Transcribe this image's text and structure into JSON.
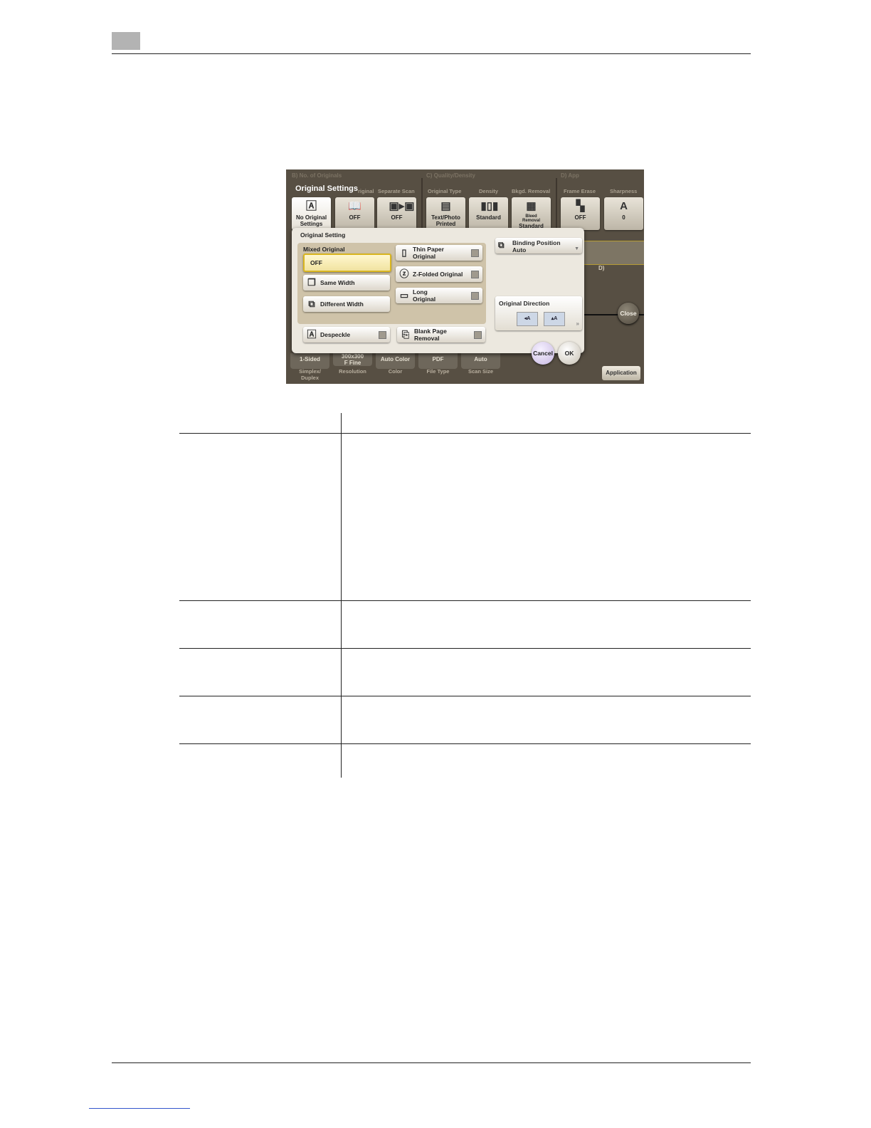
{
  "screen": {
    "sections": [
      {
        "key": "B",
        "label": "B)   No. of Originals"
      },
      {
        "key": "C",
        "label": "C)   Quality/Density"
      },
      {
        "key": "D",
        "label": "D)   App"
      }
    ],
    "title_tab": "Original Settings",
    "column_labels": {
      "orig": "riginal",
      "separate_scan": "Separate Scan",
      "original_type": "Original Type",
      "density": "Density",
      "bkgd_removal": "Bkgd. Removal",
      "frame_erase": "Frame Erase",
      "sharpness": "Sharpness"
    },
    "tiles": {
      "no_original_line1": "No Original",
      "no_original_line2": "Settings",
      "book_off": "OFF",
      "separate_scan_off": "OFF",
      "text_photo_line1": "Text/Photo",
      "text_photo_line2": "Printed",
      "density_value": "Standard",
      "bkgd_line1": "Bleed",
      "bkgd_line2": "Removal",
      "bkgd_line3": "Standard",
      "frame_erase_value": "OFF",
      "sharpness_value": "0"
    },
    "dialog": {
      "title": "Original Setting",
      "mixed_original_label": "Mixed Original",
      "mixed_off": "OFF",
      "same_width": "Same Width",
      "different_width": "Different Width",
      "thin_paper_line1": "Thin Paper",
      "thin_paper_line2": "Original",
      "z_folded": "Z-Folded Original",
      "long_line1": "Long",
      "long_line2": "Original",
      "despeckle": "Despeckle",
      "blank_page_line1": "Blank Page",
      "blank_page_line2": "Removal",
      "binding_position_label": "Binding Position",
      "binding_position_value": "Auto",
      "original_direction_label": "Original Direction",
      "cancel": "Cancel",
      "ok": "OK"
    },
    "bottom_tabs": {
      "simplex_value": "1-Sided",
      "resolution_line1": "300x300",
      "resolution_line2": "F Fine",
      "color_value": "Auto Color",
      "file_type_value": "PDF",
      "scan_size_value": "Auto"
    },
    "bottom_labels": {
      "simplex_line1": "Simplex/",
      "simplex_line2": "Duplex",
      "resolution": "Resolution",
      "color": "Color",
      "file_type": "File Type",
      "scan_size": "Scan Size"
    },
    "right_panel": {
      "d_label": "D)",
      "close": "Close",
      "application": "Application"
    },
    "accent_colors": {
      "screen_bg": "#574f43",
      "selected_border": "#d9b520",
      "dialog_bg": "#ece8df"
    }
  }
}
